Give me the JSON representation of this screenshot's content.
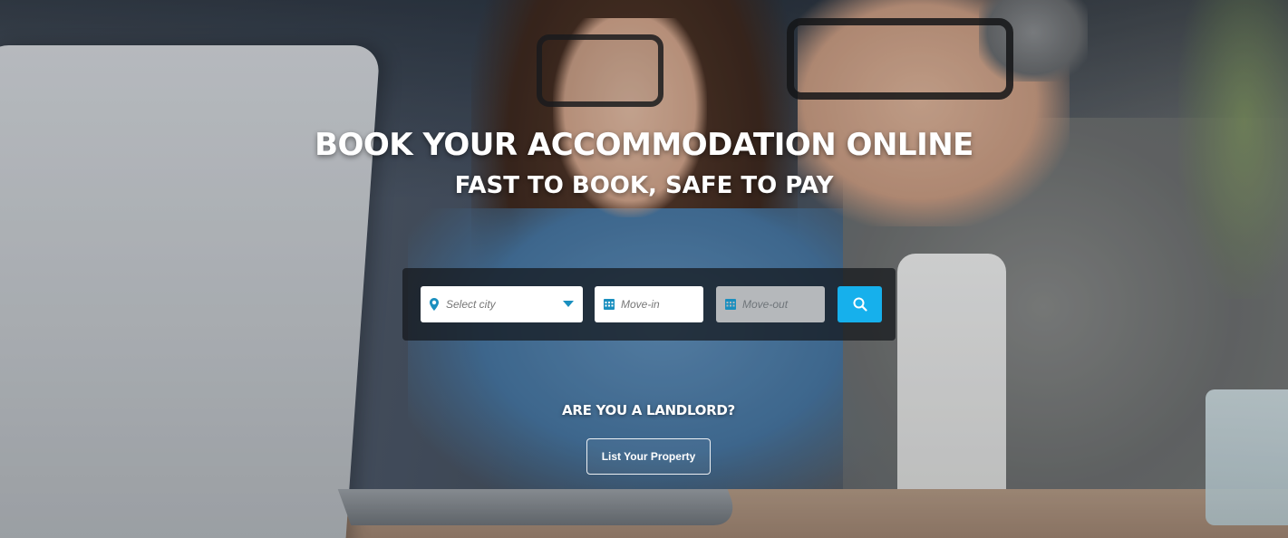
{
  "hero": {
    "headline": "BOOK YOUR ACCOMMODATION ONLINE",
    "subheadline": "FAST TO BOOK, SAFE TO PAY"
  },
  "search": {
    "city_placeholder": "Select city",
    "movein_placeholder": "Move-in",
    "moveout_placeholder": "Move-out",
    "button_icon": "search-icon",
    "accent_color": "#16b0ec"
  },
  "landlord": {
    "question": "ARE YOU A LANDLORD?",
    "button_label": "List Your Property"
  }
}
